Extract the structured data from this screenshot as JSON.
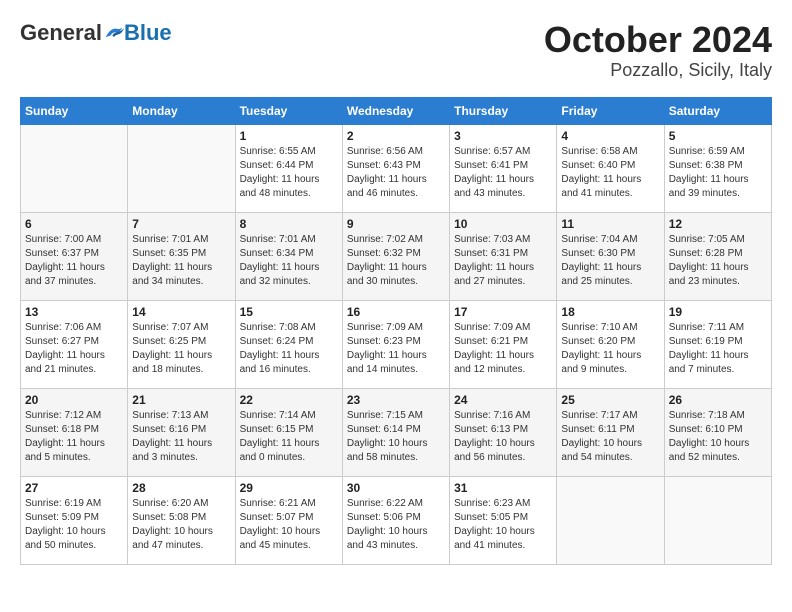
{
  "header": {
    "logo_general": "General",
    "logo_blue": "Blue",
    "month": "October 2024",
    "location": "Pozzallo, Sicily, Italy"
  },
  "calendar": {
    "weekdays": [
      "Sunday",
      "Monday",
      "Tuesday",
      "Wednesday",
      "Thursday",
      "Friday",
      "Saturday"
    ],
    "rows": [
      [
        {
          "day": "",
          "info": ""
        },
        {
          "day": "",
          "info": ""
        },
        {
          "day": "1",
          "info": "Sunrise: 6:55 AM\nSunset: 6:44 PM\nDaylight: 11 hours\nand 48 minutes."
        },
        {
          "day": "2",
          "info": "Sunrise: 6:56 AM\nSunset: 6:43 PM\nDaylight: 11 hours\nand 46 minutes."
        },
        {
          "day": "3",
          "info": "Sunrise: 6:57 AM\nSunset: 6:41 PM\nDaylight: 11 hours\nand 43 minutes."
        },
        {
          "day": "4",
          "info": "Sunrise: 6:58 AM\nSunset: 6:40 PM\nDaylight: 11 hours\nand 41 minutes."
        },
        {
          "day": "5",
          "info": "Sunrise: 6:59 AM\nSunset: 6:38 PM\nDaylight: 11 hours\nand 39 minutes."
        }
      ],
      [
        {
          "day": "6",
          "info": "Sunrise: 7:00 AM\nSunset: 6:37 PM\nDaylight: 11 hours\nand 37 minutes."
        },
        {
          "day": "7",
          "info": "Sunrise: 7:01 AM\nSunset: 6:35 PM\nDaylight: 11 hours\nand 34 minutes."
        },
        {
          "day": "8",
          "info": "Sunrise: 7:01 AM\nSunset: 6:34 PM\nDaylight: 11 hours\nand 32 minutes."
        },
        {
          "day": "9",
          "info": "Sunrise: 7:02 AM\nSunset: 6:32 PM\nDaylight: 11 hours\nand 30 minutes."
        },
        {
          "day": "10",
          "info": "Sunrise: 7:03 AM\nSunset: 6:31 PM\nDaylight: 11 hours\nand 27 minutes."
        },
        {
          "day": "11",
          "info": "Sunrise: 7:04 AM\nSunset: 6:30 PM\nDaylight: 11 hours\nand 25 minutes."
        },
        {
          "day": "12",
          "info": "Sunrise: 7:05 AM\nSunset: 6:28 PM\nDaylight: 11 hours\nand 23 minutes."
        }
      ],
      [
        {
          "day": "13",
          "info": "Sunrise: 7:06 AM\nSunset: 6:27 PM\nDaylight: 11 hours\nand 21 minutes."
        },
        {
          "day": "14",
          "info": "Sunrise: 7:07 AM\nSunset: 6:25 PM\nDaylight: 11 hours\nand 18 minutes."
        },
        {
          "day": "15",
          "info": "Sunrise: 7:08 AM\nSunset: 6:24 PM\nDaylight: 11 hours\nand 16 minutes."
        },
        {
          "day": "16",
          "info": "Sunrise: 7:09 AM\nSunset: 6:23 PM\nDaylight: 11 hours\nand 14 minutes."
        },
        {
          "day": "17",
          "info": "Sunrise: 7:09 AM\nSunset: 6:21 PM\nDaylight: 11 hours\nand 12 minutes."
        },
        {
          "day": "18",
          "info": "Sunrise: 7:10 AM\nSunset: 6:20 PM\nDaylight: 11 hours\nand 9 minutes."
        },
        {
          "day": "19",
          "info": "Sunrise: 7:11 AM\nSunset: 6:19 PM\nDaylight: 11 hours\nand 7 minutes."
        }
      ],
      [
        {
          "day": "20",
          "info": "Sunrise: 7:12 AM\nSunset: 6:18 PM\nDaylight: 11 hours\nand 5 minutes."
        },
        {
          "day": "21",
          "info": "Sunrise: 7:13 AM\nSunset: 6:16 PM\nDaylight: 11 hours\nand 3 minutes."
        },
        {
          "day": "22",
          "info": "Sunrise: 7:14 AM\nSunset: 6:15 PM\nDaylight: 11 hours\nand 0 minutes."
        },
        {
          "day": "23",
          "info": "Sunrise: 7:15 AM\nSunset: 6:14 PM\nDaylight: 10 hours\nand 58 minutes."
        },
        {
          "day": "24",
          "info": "Sunrise: 7:16 AM\nSunset: 6:13 PM\nDaylight: 10 hours\nand 56 minutes."
        },
        {
          "day": "25",
          "info": "Sunrise: 7:17 AM\nSunset: 6:11 PM\nDaylight: 10 hours\nand 54 minutes."
        },
        {
          "day": "26",
          "info": "Sunrise: 7:18 AM\nSunset: 6:10 PM\nDaylight: 10 hours\nand 52 minutes."
        }
      ],
      [
        {
          "day": "27",
          "info": "Sunrise: 6:19 AM\nSunset: 5:09 PM\nDaylight: 10 hours\nand 50 minutes."
        },
        {
          "day": "28",
          "info": "Sunrise: 6:20 AM\nSunset: 5:08 PM\nDaylight: 10 hours\nand 47 minutes."
        },
        {
          "day": "29",
          "info": "Sunrise: 6:21 AM\nSunset: 5:07 PM\nDaylight: 10 hours\nand 45 minutes."
        },
        {
          "day": "30",
          "info": "Sunrise: 6:22 AM\nSunset: 5:06 PM\nDaylight: 10 hours\nand 43 minutes."
        },
        {
          "day": "31",
          "info": "Sunrise: 6:23 AM\nSunset: 5:05 PM\nDaylight: 10 hours\nand 41 minutes."
        },
        {
          "day": "",
          "info": ""
        },
        {
          "day": "",
          "info": ""
        }
      ]
    ]
  }
}
